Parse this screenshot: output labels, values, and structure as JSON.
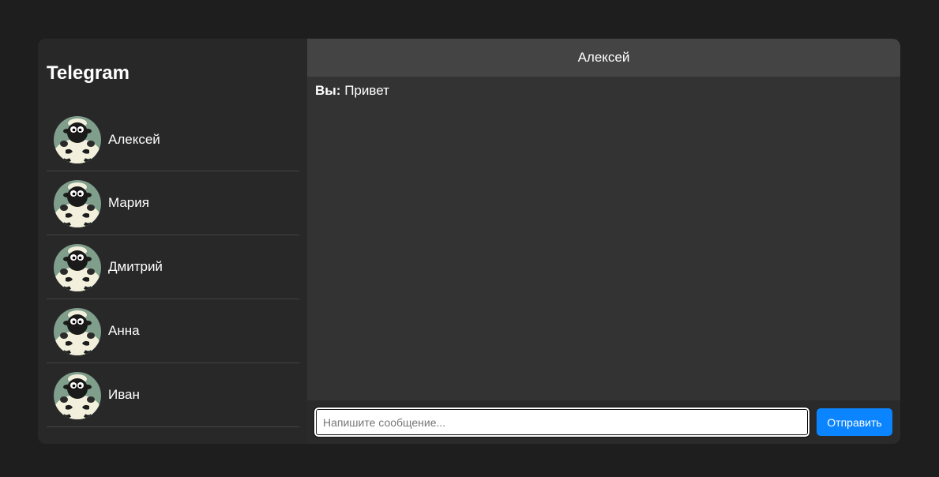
{
  "sidebar": {
    "title": "Telegram",
    "contacts": [
      {
        "name": "Алексей",
        "avatar": "sheep-avatar"
      },
      {
        "name": "Мария",
        "avatar": "sheep-avatar"
      },
      {
        "name": "Дмитрий",
        "avatar": "sheep-avatar"
      },
      {
        "name": "Анна",
        "avatar": "sheep-avatar"
      },
      {
        "name": "Иван",
        "avatar": "sheep-avatar"
      }
    ]
  },
  "chat": {
    "header_title": "Алексей",
    "messages": [
      {
        "sender": "Вы:",
        "text": "Привет"
      }
    ]
  },
  "composer": {
    "placeholder": "Напишите сообщение...",
    "value": "",
    "send_label": "Отправить"
  },
  "colors": {
    "accent": "#0a84ff",
    "background": "#1e1e1e",
    "sidebar": "#282828",
    "chat_background": "#333333",
    "header": "#444444"
  }
}
